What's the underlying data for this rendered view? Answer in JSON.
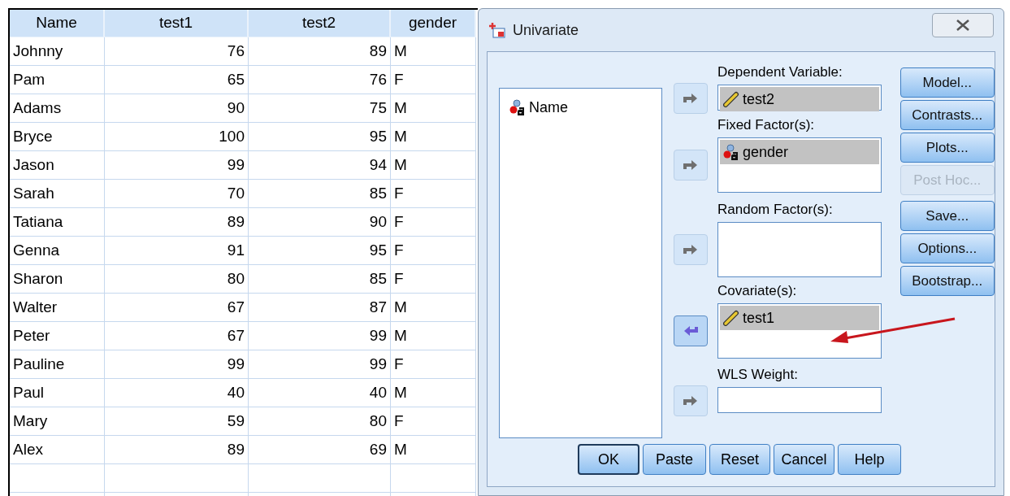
{
  "table": {
    "columns": [
      "Name",
      "test1",
      "test2",
      "gender"
    ],
    "rows": [
      [
        "Johnny",
        "76",
        "89",
        "M"
      ],
      [
        "Pam",
        "65",
        "76",
        "F"
      ],
      [
        "Adams",
        "90",
        "75",
        "M"
      ],
      [
        "Bryce",
        "100",
        "95",
        "M"
      ],
      [
        "Jason",
        "99",
        "94",
        "M"
      ],
      [
        "Sarah",
        "70",
        "85",
        "F"
      ],
      [
        "Tatiana",
        "89",
        "90",
        "F"
      ],
      [
        "Genna",
        "91",
        "95",
        "F"
      ],
      [
        "Sharon",
        "80",
        "85",
        "F"
      ],
      [
        "Walter",
        "67",
        "87",
        "M"
      ],
      [
        "Peter",
        "67",
        "99",
        "M"
      ],
      [
        "Pauline",
        "99",
        "99",
        "F"
      ],
      [
        "Paul",
        "40",
        "40",
        "M"
      ],
      [
        "Mary",
        "59",
        "80",
        "F"
      ],
      [
        "Alex",
        "89",
        "69",
        "M"
      ]
    ]
  },
  "dialog": {
    "title": "Univariate",
    "source_list": [
      {
        "label": "Name",
        "kind": "nominal",
        "selected": false
      }
    ],
    "targets": [
      {
        "label": "Dependent Variable:",
        "active": false,
        "kind": "single",
        "items": [
          {
            "label": "test2",
            "kind": "scale",
            "selected": true
          }
        ]
      },
      {
        "label": "Fixed Factor(s):",
        "active": false,
        "kind": "multi",
        "items": [
          {
            "label": "gender",
            "kind": "nominal",
            "selected": true
          }
        ]
      },
      {
        "label": "Random Factor(s):",
        "active": false,
        "kind": "multi"
      },
      {
        "label": "Covariate(s):",
        "active": true,
        "kind": "multi",
        "items": [
          {
            "label": "test1",
            "kind": "scale",
            "selected": true
          }
        ]
      },
      {
        "label": "WLS Weight:",
        "active": false,
        "kind": "single"
      }
    ],
    "side_buttons": [
      {
        "label": "Model...",
        "disabled": false
      },
      {
        "label": "Contrasts...",
        "disabled": false
      },
      {
        "label": "Plots...",
        "disabled": false
      },
      {
        "label": "Post Hoc...",
        "disabled": true
      },
      {
        "label": "Save...",
        "disabled": false
      },
      {
        "label": "Options...",
        "disabled": false
      },
      {
        "label": "Bootstrap...",
        "disabled": false
      }
    ],
    "bottom_buttons": [
      {
        "label": "OK",
        "default": true
      },
      {
        "label": "Paste",
        "default": false
      },
      {
        "label": "Reset",
        "default": false
      },
      {
        "label": "Cancel",
        "default": false
      },
      {
        "label": "Help",
        "default": false
      }
    ]
  }
}
